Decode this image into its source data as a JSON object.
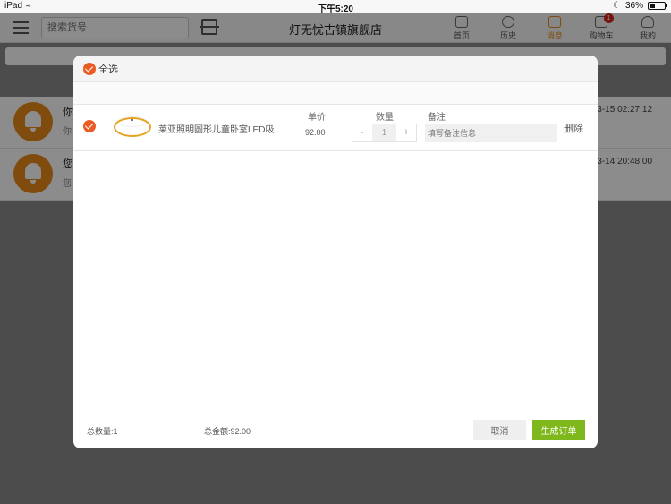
{
  "status_bar": {
    "device": "iPad",
    "time": "下午5:20",
    "battery_percent": "36%",
    "battery_level": 0.36
  },
  "header": {
    "search_placeholder": "搜索货号",
    "store_title": "灯无忧古镇旗舰店",
    "nav_tabs": [
      {
        "label": "首页",
        "icon": "home-icon"
      },
      {
        "label": "历史",
        "icon": "clock-icon"
      },
      {
        "label": "消息",
        "icon": "message-icon",
        "active": true
      },
      {
        "label": "购物车",
        "icon": "cart-icon",
        "badge": "1"
      },
      {
        "label": "我的",
        "icon": "user-icon"
      }
    ]
  },
  "background_messages": [
    {
      "title": "你",
      "subtitle": "你",
      "time": "03-15 02:27:12"
    },
    {
      "title": "您",
      "subtitle": "您",
      "time": "03-14 20:48:00"
    }
  ],
  "modal": {
    "select_all_label": "全选",
    "columns": {
      "price": "单价",
      "quantity": "数量",
      "note": "备注"
    },
    "items": [
      {
        "name": "莱亚照明圆形儿童卧室LED吸...",
        "price": "92.00",
        "quantity": "1",
        "note_placeholder": "填写备注信息",
        "delete_label": "删除",
        "checked": true
      }
    ],
    "stepper": {
      "minus": "-",
      "plus": "+"
    },
    "total_quantity": "总数量:1",
    "total_amount": "总金额:92.00",
    "cancel_label": "取消",
    "submit_label": "生成订单"
  },
  "colors": {
    "accent_orange": "#ea5b24",
    "bell_orange": "#e98a1b",
    "submit_green": "#7fb81c",
    "badge_red": "#d9261c"
  }
}
